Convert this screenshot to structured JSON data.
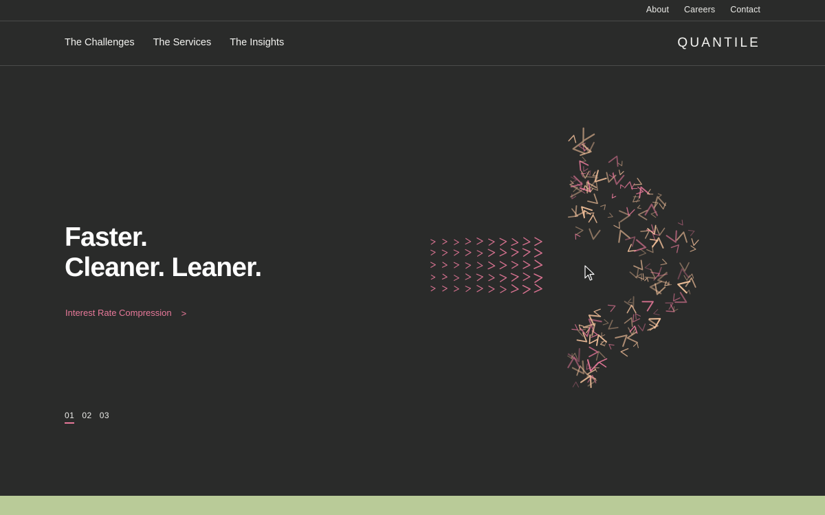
{
  "utility_nav": {
    "items": [
      "About",
      "Careers",
      "Contact"
    ]
  },
  "main_nav": {
    "items": [
      "The Challenges",
      "The Services",
      "The Insights"
    ],
    "logo": "QUANTILE"
  },
  "hero": {
    "heading_line1": "Faster.",
    "heading_line2": "Cleaner. Leaner.",
    "link_label": "Interest Rate Compression",
    "link_chevron": ">"
  },
  "pager": {
    "pages": [
      "01",
      "02",
      "03"
    ],
    "active_index": 0
  },
  "colors": {
    "background": "#2a2b2a",
    "accent_pink": "#e8799a",
    "accent_peach": "#f2c09a",
    "footer_green": "#b9cb98",
    "divider": "#4a4b4a"
  },
  "icons": {
    "cursor": "mouse-pointer-icon",
    "chevron": "chevron-right-icon"
  }
}
